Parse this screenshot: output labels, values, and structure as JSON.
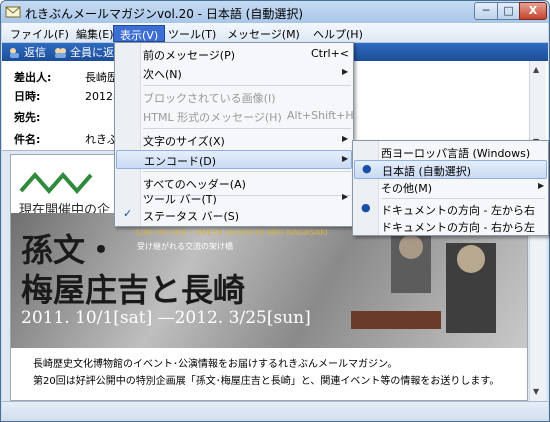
{
  "window": {
    "title": "れきぶんメールマガジンvol.20 - 日本語 (自動選択)",
    "min_label": "─",
    "max_label": "□",
    "close_label": "X"
  },
  "menubar": {
    "items": [
      "ファイル(F)",
      "編集(E)",
      "表示(V)",
      "ツール(T)",
      "メッセージ(M)",
      "ヘルプ(H)"
    ]
  },
  "toolbar": {
    "reply": "返信",
    "reply_all": "全員に返信"
  },
  "header": {
    "from_label": "差出人:",
    "from_value": "長崎歴史",
    "date_label": "日時:",
    "date_value": "2012年",
    "to_label": "宛先:",
    "subject_label": "件名:",
    "subject_value": "れきぶん"
  },
  "view_menu": {
    "items": [
      {
        "label": "前のメッセージ(P)",
        "shortcut": "Ctrl+<"
      },
      {
        "label": "次へ(N)"
      },
      {
        "label": "ブロックされている画像(I)"
      },
      {
        "label": "HTML 形式のメッセージ(H)",
        "shortcut": "Alt+Shift+H"
      },
      {
        "label": "文字のサイズ(X)"
      },
      {
        "label": "エンコード(D)"
      },
      {
        "label": "すべてのヘッダー(A)"
      },
      {
        "label": "ツール バー(T)"
      },
      {
        "label": "ステータス バー(S)"
      }
    ]
  },
  "encoding_menu": {
    "items": [
      {
        "label": "西ヨーロッパ言語 (Windows)"
      },
      {
        "label": "日本語 (自動選択)"
      },
      {
        "label": "その他(M)"
      },
      {
        "label": "ドキュメントの方向 - 左から右"
      },
      {
        "label": "ドキュメントの方向 - 右から左"
      }
    ]
  },
  "marks": {
    "check": "✓",
    "radio": "●",
    "submenu": "▶"
  },
  "banner": {
    "heading": "現在開催中の企",
    "title1": "孫文・",
    "title2": "梅屋庄吉と長崎",
    "sub_en": "SUN YAT-SEN・UMEYA SHOKICHI AND NAGASAKI",
    "sub_jp": "受け継がれる交流の架け橋",
    "dates": "2011. 10/1[sat] —2012. 3/25[sun]"
  },
  "message": {
    "line1": "長崎歴史文化博物館のイベント･公演情報をお届けするれきぶんメールマガジン。",
    "line2": "第20回は好評公開中の特別企画展「孫文･梅屋庄吉と長崎」と、関連イベント等の情報をお送りします。"
  },
  "colors": {
    "menu_highlight": "#3c6ed3",
    "toolbar": "#1f55a3"
  }
}
